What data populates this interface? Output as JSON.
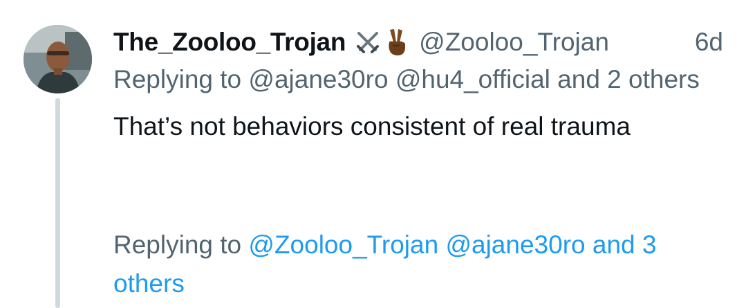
{
  "tweet": {
    "display_name": "The_Zooloo_Trojan",
    "handle": "@Zooloo_Trojan",
    "time": "6d",
    "emoji_icons": [
      "crossed-swords-icon",
      "victory-hand-icon"
    ],
    "replying_prefix": "Replying to ",
    "replying_mentions": "@ajane30ro @hu4_official and 2 others",
    "text": "That’s not behaviors consistent of real trauma"
  },
  "next_reply": {
    "replying_prefix": "Replying to ",
    "replying_mentions": "@Zooloo_Trojan @ajane30ro and 3 others"
  },
  "colors": {
    "primary_text": "#0f1419",
    "secondary_text": "#536471",
    "link": "#1d9bf0",
    "thread_line": "#cfd9de"
  }
}
